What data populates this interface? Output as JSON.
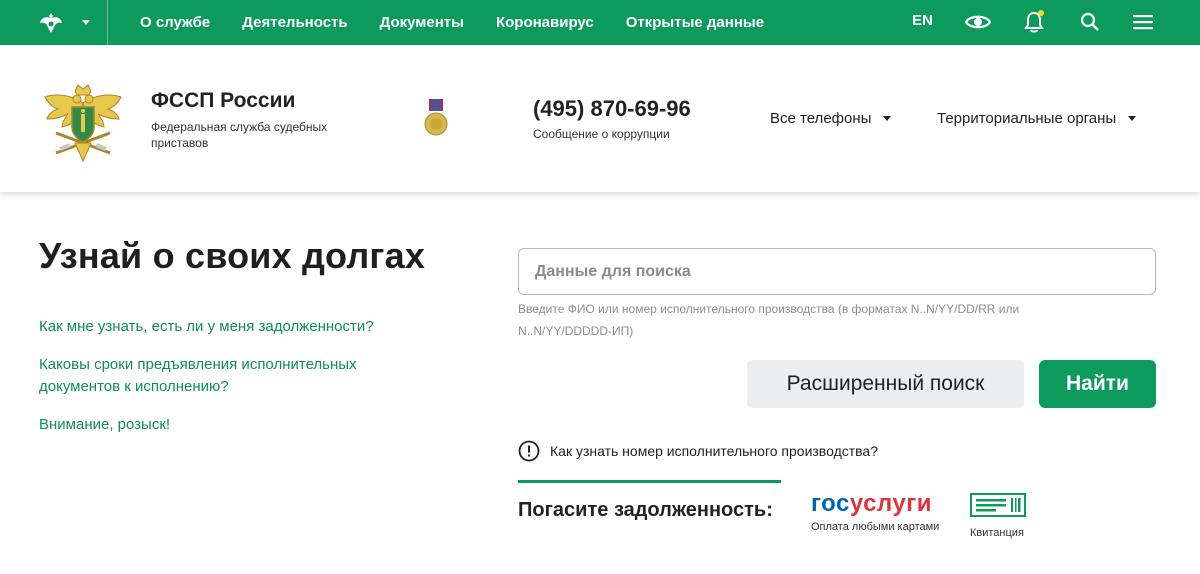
{
  "topbar": {
    "nav": [
      "О службе",
      "Деятельность",
      "Документы",
      "Коронавирус",
      "Открытые данные"
    ],
    "lang": "EN",
    "icons": [
      "visibility-icon",
      "bell-icon",
      "search-icon",
      "menu-icon"
    ]
  },
  "header": {
    "org_name": "ФССП России",
    "org_sub": "Федеральная служба судебных приставов",
    "phone": "(495) 870-69-96",
    "phone_sub": "Сообщение о коррупции",
    "all_phones": "Все телефоны",
    "territorial": "Территориальные органы"
  },
  "main": {
    "title": "Узнай о своих долгах",
    "links": [
      "Как мне узнать, есть ли у меня задолженности?",
      "Каковы сроки предъявления исполнительных документов к исполнению?",
      "Внимание, розыск!"
    ],
    "search_placeholder": "Данные для поиска",
    "search_hint": "Введите ФИО или номер исполнительного производства (в форматах N..N/YY/DD/RR или N..N/YY/DDDDD-ИП)",
    "advanced_button": "Расширенный поиск",
    "find_button": "Найти",
    "info_link": "Как узнать номер исполнительного производства?",
    "pay_label": "Погасите задолженность:",
    "gosuslugi_a": "гос",
    "gosuslugi_b": "услуги",
    "gosuslugi_sub": "Оплата любыми картами",
    "receipt_label": "Квитанция"
  },
  "colors": {
    "accent": "#0d9a5d",
    "link": "#0d8f55",
    "gos_blue": "#0066b3",
    "gos_red": "#e0323c",
    "notify_dot": "#f3d92c"
  }
}
